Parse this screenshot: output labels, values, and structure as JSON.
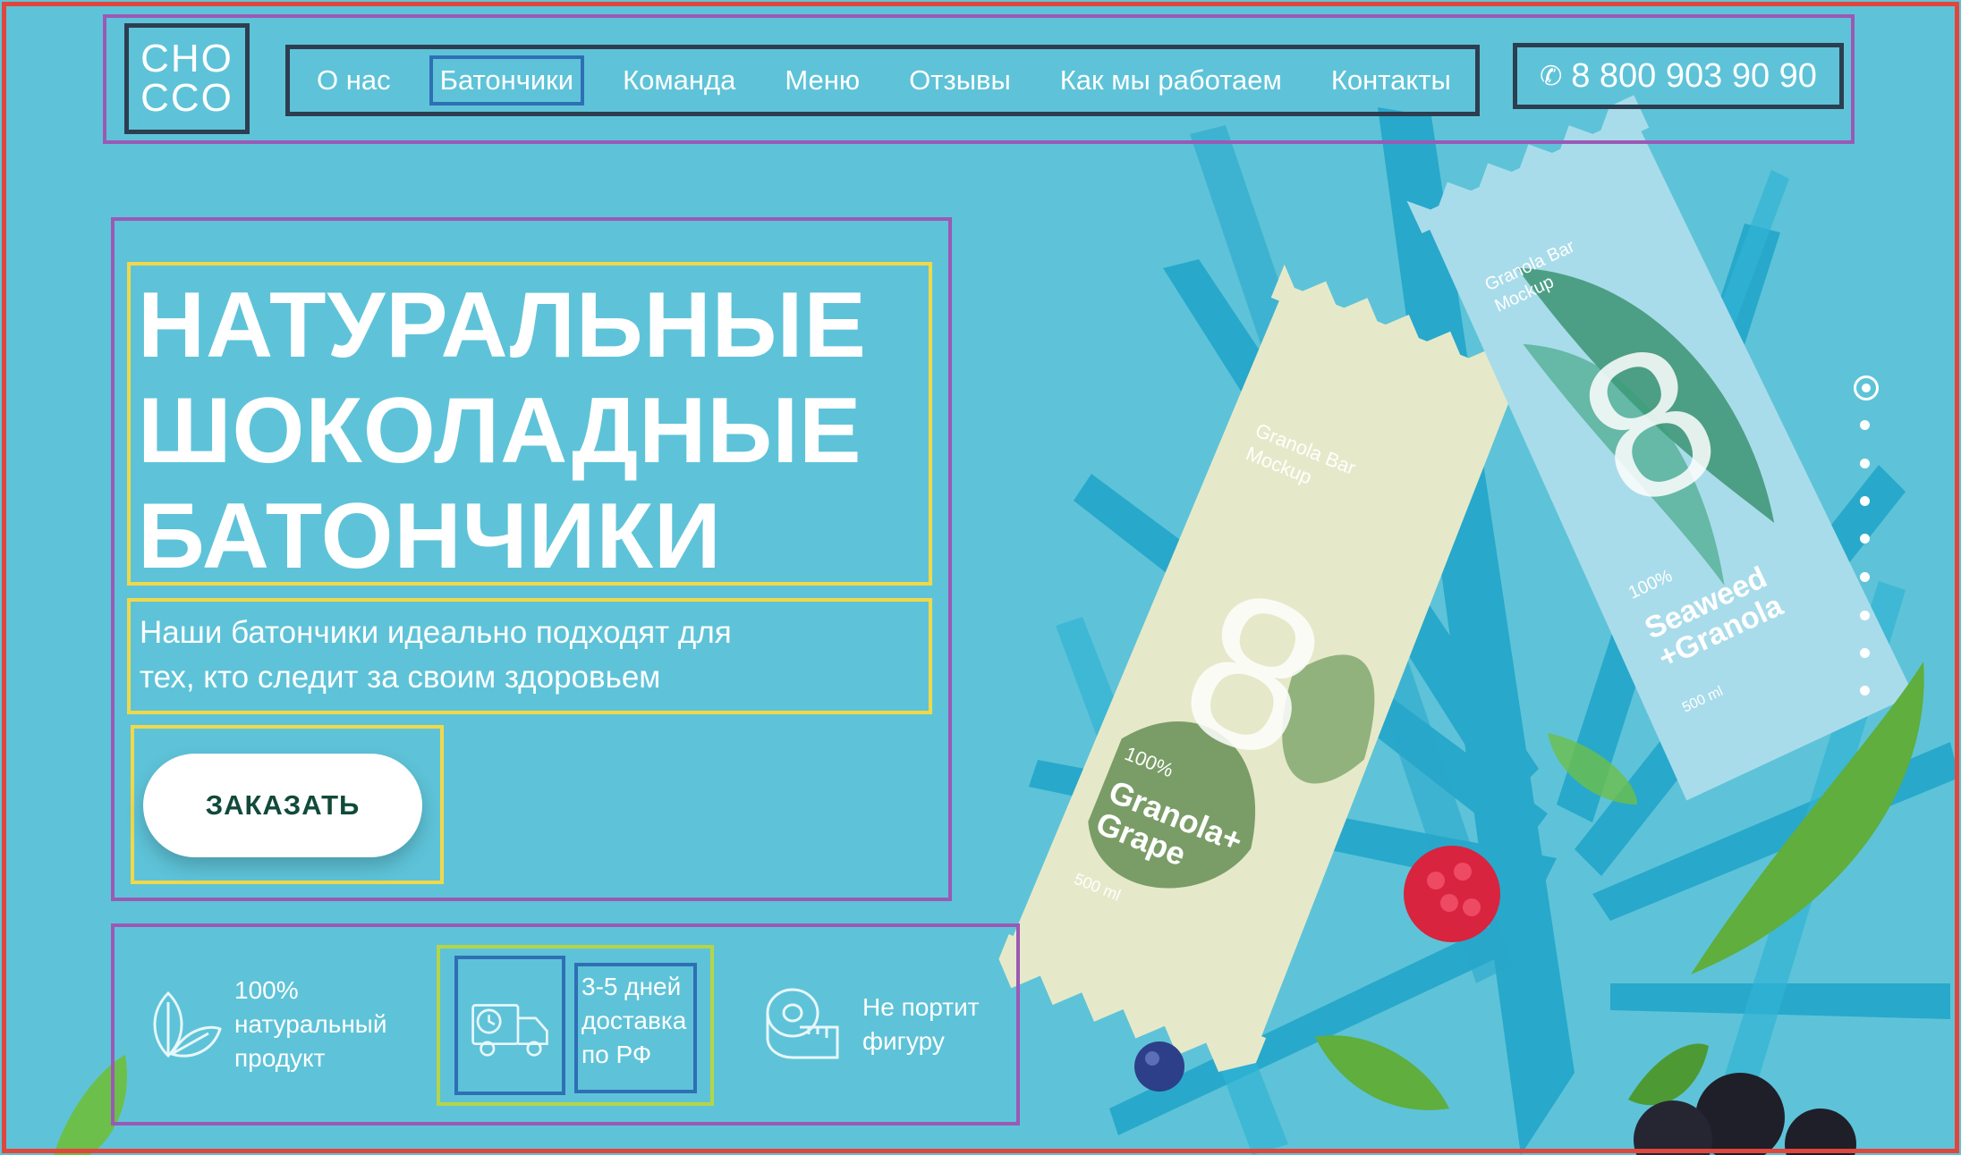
{
  "header": {
    "logo_line1": "CHO",
    "logo_line2": "CCO",
    "nav": [
      {
        "label": "О нас",
        "active": false
      },
      {
        "label": "Батончики",
        "active": true
      },
      {
        "label": "Команда",
        "active": false
      },
      {
        "label": "Меню",
        "active": false
      },
      {
        "label": "Отзывы",
        "active": false
      },
      {
        "label": "Как мы работаем",
        "active": false
      },
      {
        "label": "Контакты",
        "active": false
      }
    ],
    "phone": "8 800 903 90 90",
    "phone_icon": "phone-icon"
  },
  "hero": {
    "title_lines": [
      "НАТУРАЛЬНЫЕ",
      "ШОКОЛАДНЫЕ",
      "БАТОНЧИКИ"
    ],
    "subtitle_lines": [
      "Наши батончики идеально подходят для",
      "тех, кто следит за своим здоровьем"
    ],
    "cta": "ЗАКАЗАТЬ"
  },
  "features": [
    {
      "icon": "leaf-icon",
      "lines": [
        "100%",
        "натуральный",
        "продукт"
      ]
    },
    {
      "icon": "delivery-truck-icon",
      "lines": [
        "3-5 дней",
        "доставка",
        "по РФ"
      ]
    },
    {
      "icon": "measuring-tape-icon",
      "lines": [
        "Не портит",
        "фигуру"
      ]
    }
  ],
  "products": [
    {
      "number": "8",
      "brand": "Granola Bar",
      "sub": "Mockup",
      "percent": "100%",
      "flavor_line1": "Granola+",
      "flavor_line2": "Grape",
      "volume": "500 ml"
    },
    {
      "number": "8",
      "brand": "Granola Bar",
      "sub": "Mockup",
      "percent": "100%",
      "flavor_line1": "Seaweed",
      "flavor_line2": "+Granola",
      "volume": "500 ml"
    }
  ],
  "pager": {
    "count": 9,
    "active_index": 0
  },
  "colors": {
    "background": "#5ec3d8",
    "button_text": "#114a3a",
    "bar_cream": "#e6e9c9",
    "bar_blue": "#a9dcea"
  }
}
